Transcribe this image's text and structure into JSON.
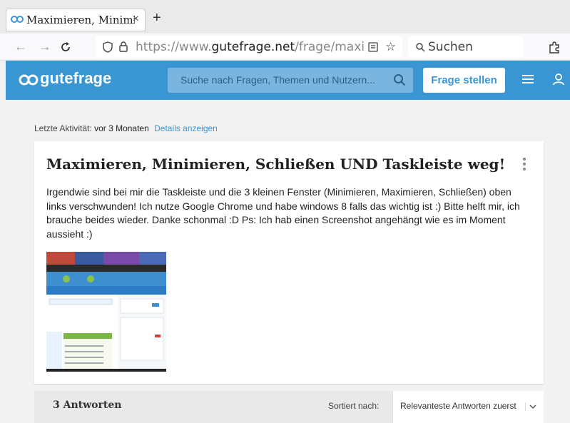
{
  "browser": {
    "tab_title": "Maximieren, Minimieren, Schließen UND Taskleiste weg!",
    "tab_close": "×",
    "new_tab": "+",
    "url_prefix": "https://www.",
    "url_domain": "gutefrage.net",
    "url_path": "/frage/maximieren-minimieren-schliessen-und-taskleiste-weg",
    "search_placeholder": "Suchen"
  },
  "site": {
    "logo_text": "gutefrage",
    "search_placeholder": "Suche nach Fragen, Themen und Nutzern...",
    "ask_button": "Frage stellen",
    "brand_color": "#3a96d2"
  },
  "activity": {
    "label": "Letzte Aktivität:",
    "when": "vor 3 Monaten",
    "details": "Details anzeigen"
  },
  "question": {
    "title": "Maximieren, Minimieren, Schließen UND Taskleiste weg!",
    "body": "Irgendwie sind bei mir die Taskleiste und die 3 kleinen Fenster (Minimieren, Maximieren, Schließen) oben links verschwunden! Ich nutze Google Chrome und habe windows 8 falls das wichtig ist :) Bitte helft mir, ich brauche beides wieder. Danke schonmal :D Ps: Ich hab einen Screenshot angehängt wie es im Moment aussieht :)"
  },
  "answers": {
    "count": "3 Antworten",
    "sort_label": "Sortiert nach:",
    "sort_value": "Relevanteste Antworten zuerst"
  }
}
